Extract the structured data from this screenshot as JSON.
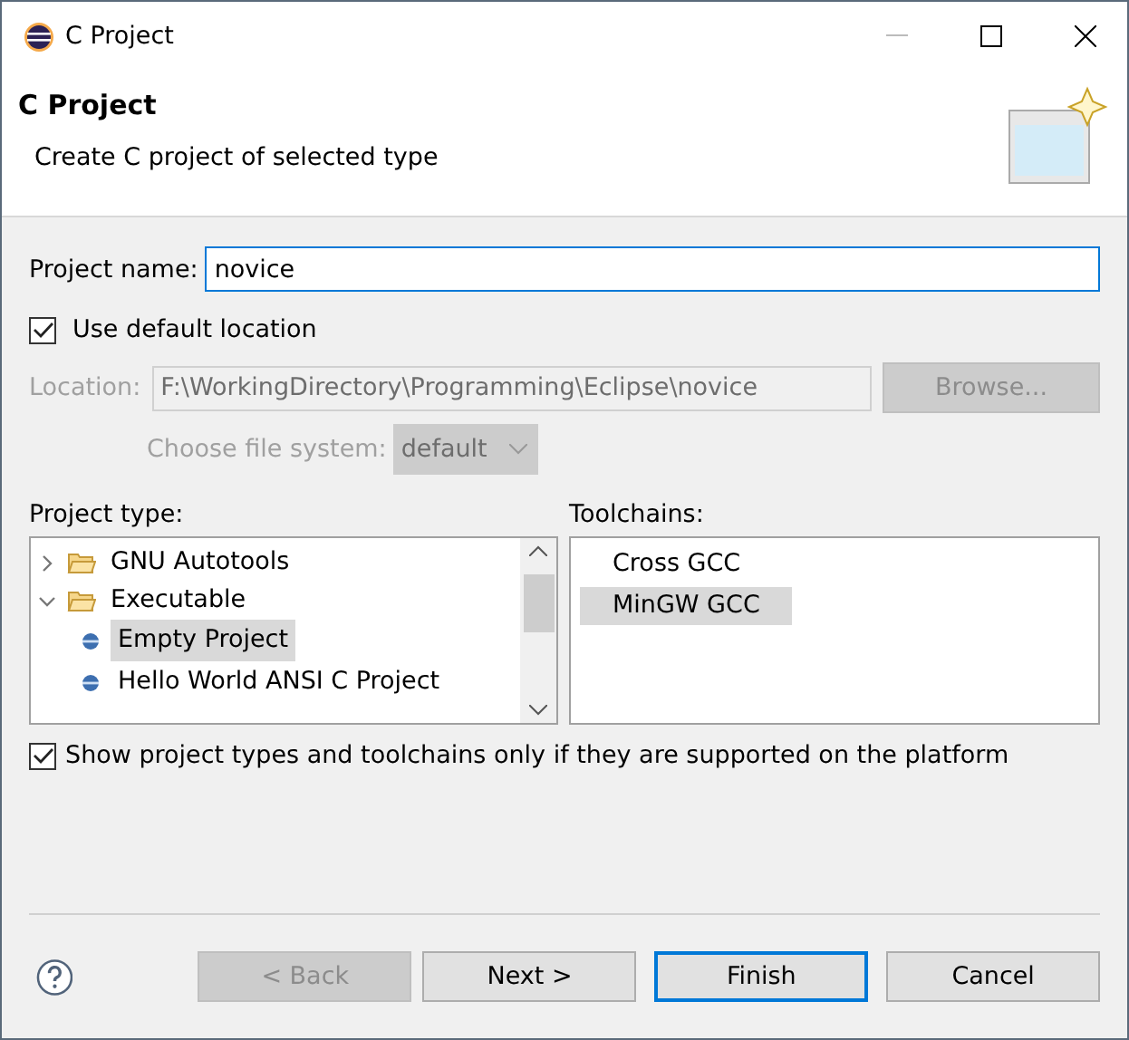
{
  "window": {
    "title": "C Project"
  },
  "header": {
    "title": "C Project",
    "description": "Create C project of selected type"
  },
  "project_name": {
    "label": "Project name:",
    "value": "novice"
  },
  "use_default_location": {
    "label": "Use default location",
    "checked": true
  },
  "location": {
    "label": "Location:",
    "value": "F:\\WorkingDirectory\\Programming\\Eclipse\\novice",
    "disabled": true,
    "browse": "Browse..."
  },
  "file_system": {
    "label": "Choose file system:",
    "value": "default",
    "disabled": true
  },
  "project_type": {
    "label": "Project type:",
    "items": [
      {
        "label": "GNU Autotools",
        "expanded": false,
        "selected": false
      },
      {
        "label": "Executable",
        "expanded": true,
        "selected": false,
        "children": [
          {
            "label": "Empty Project",
            "selected": true
          },
          {
            "label": "Hello World ANSI C Project",
            "selected": false
          }
        ]
      }
    ]
  },
  "toolchains": {
    "label": "Toolchains:",
    "items": [
      {
        "label": "Cross GCC",
        "selected": false
      },
      {
        "label": "MinGW GCC",
        "selected": true
      }
    ]
  },
  "show_supported": {
    "label": "Show project types and toolchains only if they are supported on the platform",
    "checked": true
  },
  "buttons": [
    {
      "label": "< Back",
      "disabled": true,
      "default": false
    },
    {
      "label": "Next >",
      "disabled": false,
      "default": false
    },
    {
      "label": "Finish",
      "disabled": false,
      "default": true
    },
    {
      "label": "Cancel",
      "disabled": false,
      "default": false
    }
  ]
}
